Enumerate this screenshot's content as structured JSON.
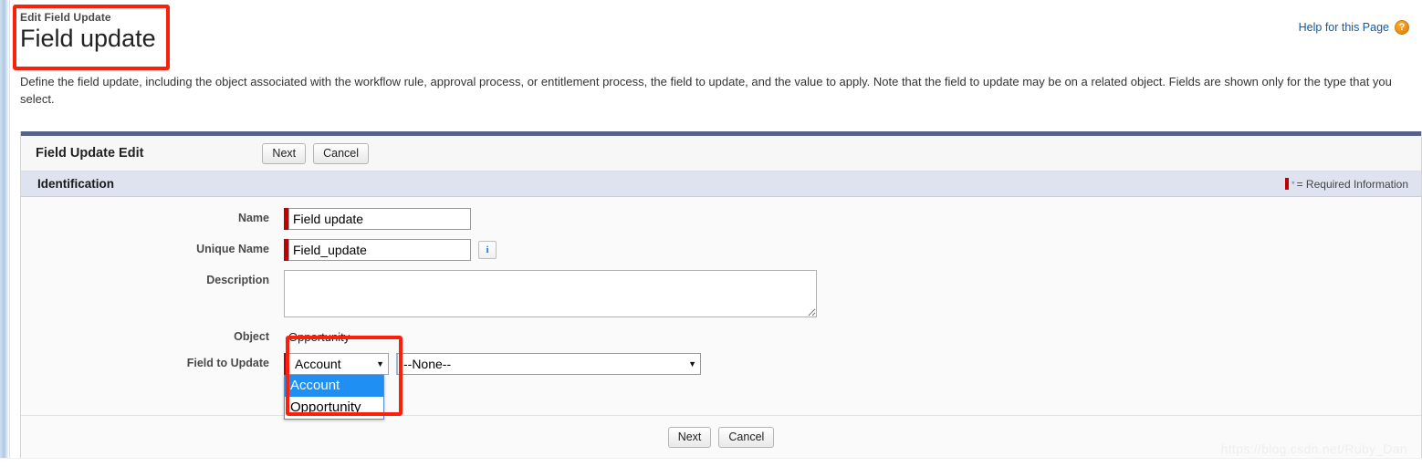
{
  "header": {
    "eyebrow": "Edit Field Update",
    "title": "Field update",
    "help_label": "Help for this Page",
    "help_icon": "question-mark-icon"
  },
  "description": "Define the field update, including the object associated with the workflow rule, approval process, or entitlement process, the field to update, and the value to apply. Note that the field to update may be on a related object. Fields are shown only for the type that you select.",
  "panel": {
    "title": "Field Update Edit",
    "next_label": "Next",
    "cancel_label": "Cancel",
    "section_title": "Identification",
    "required_legend": "= Required Information",
    "required_star": "*"
  },
  "form": {
    "name": {
      "label": "Name",
      "value": "Field update",
      "placeholder": ""
    },
    "unique_name": {
      "label": "Unique Name",
      "value": "Field_update",
      "placeholder": "",
      "info_icon": "info-icon"
    },
    "description": {
      "label": "Description",
      "value": "",
      "placeholder": ""
    },
    "object": {
      "label": "Object",
      "value": "Opportunity"
    },
    "field_to_update": {
      "label": "Field to Update",
      "object_select": {
        "selected": "Account",
        "options": [
          "Account",
          "Opportunity"
        ],
        "expanded": true
      },
      "field_select": {
        "selected": "--None--",
        "options": [
          "--None--"
        ]
      }
    }
  },
  "footer": {
    "next_label": "Next",
    "cancel_label": "Cancel"
  },
  "watermark": "https://blog.csdn.net/Ruby_Dan",
  "colors": {
    "accent_blue": "#1658a0",
    "required_red": "#c00000",
    "annotation_red": "#fb1f0c",
    "highlight_blue": "#1f8ff4",
    "panel_topbar": "#56618a",
    "section_bar": "#dee3ef",
    "help_icon_orange": "#e8870d"
  }
}
